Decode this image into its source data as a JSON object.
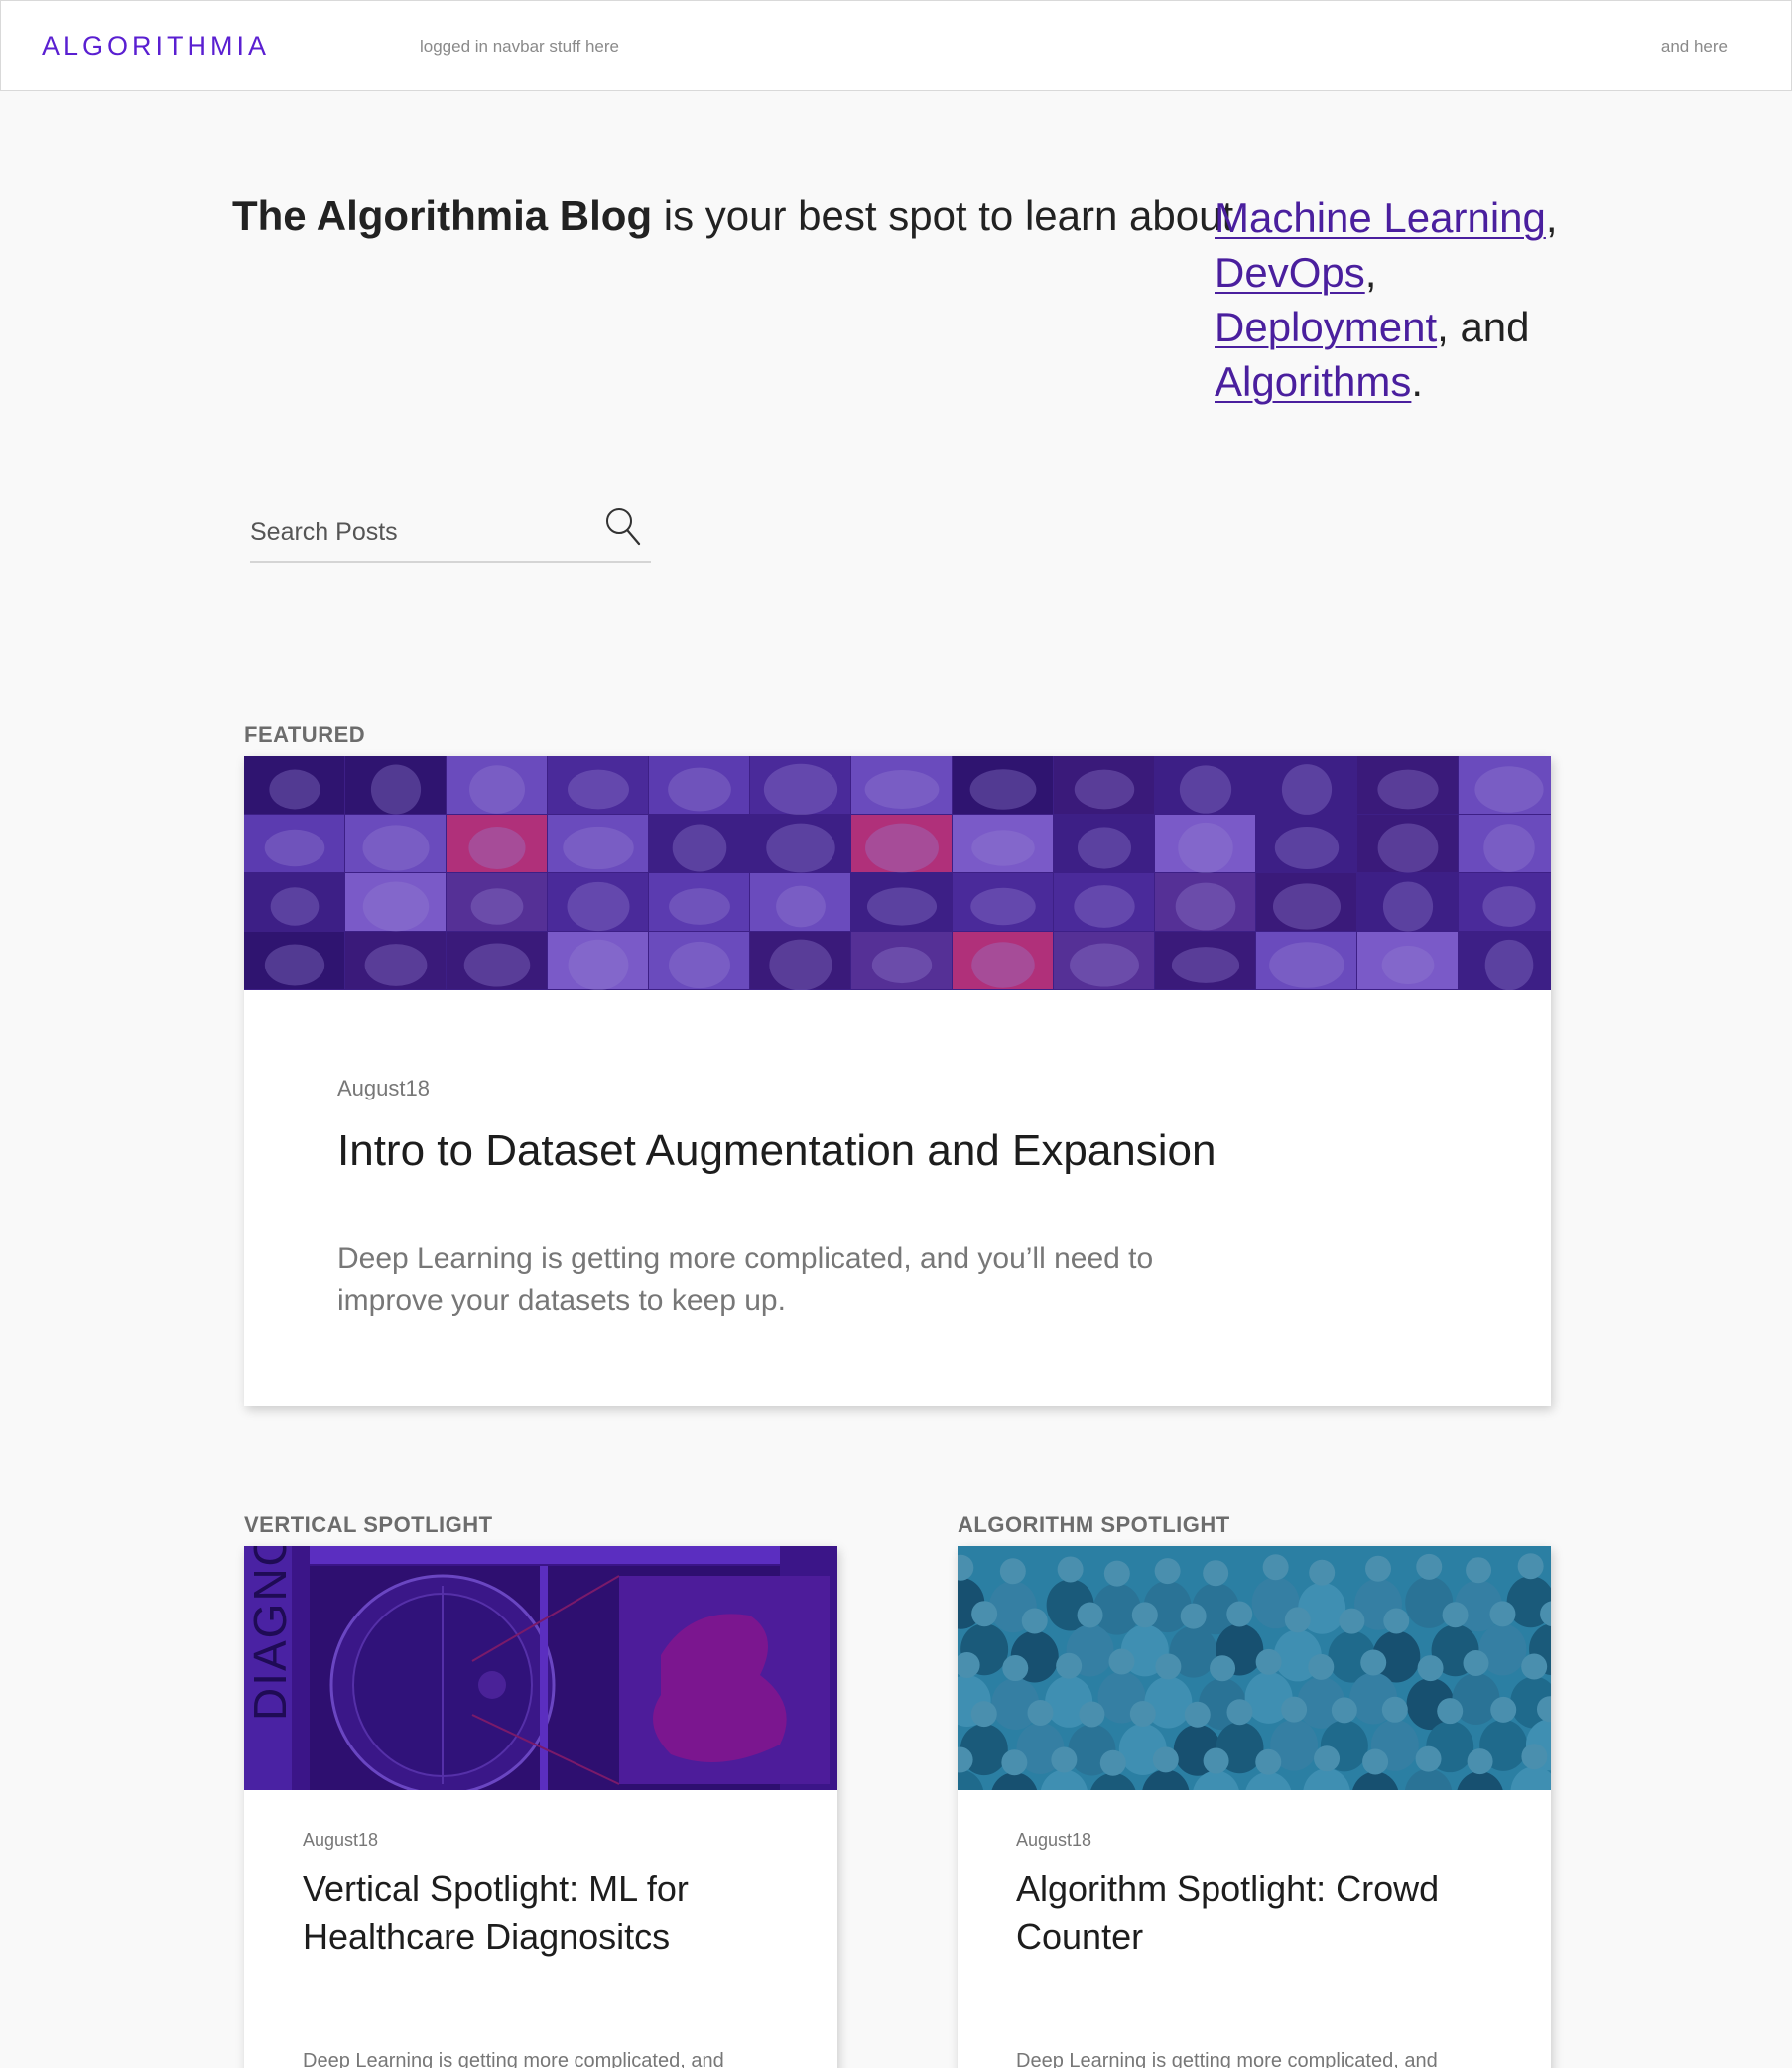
{
  "navbar": {
    "logo": "ALGORITHMIA",
    "left_text": "logged in navbar stuff here",
    "right_text": "and here"
  },
  "hero": {
    "blog_name": "The Algorithmia Blog",
    "tagline": " is your best spot to learn about",
    "topics": [
      "Machine Learning",
      "DevOps",
      "Deployment",
      "Algorithms"
    ],
    "sep1": ",",
    "sep2": ",",
    "sep3": ", and",
    "end": "."
  },
  "search": {
    "placeholder": "Search Posts"
  },
  "featured": {
    "label": "FEATURED",
    "date": "August18",
    "title": "Intro to Dataset Augmentation and Expansion",
    "excerpt": "Deep Learning is getting more complicated, and you’ll need to improve your datasets to keep up."
  },
  "vertical_spotlight": {
    "label": "VERTICAL SPOTLIGHT",
    "date": "August18",
    "title": "Vertical Spotlight: ML for Healthcare Diagnositcs",
    "excerpt": "Deep Learning is getting more complicated, and",
    "image_text": "DIAGNO"
  },
  "algorithm_spotlight": {
    "label": "ALGORITHM SPOTLIGHT",
    "date": "August18",
    "title": "Algorithm Spotlight: Crowd Counter",
    "excerpt": "Deep Learning is getting more complicated, and"
  },
  "colors": {
    "brand": "#5a1fd1",
    "link": "#4a1f9e",
    "background": "#f9f9f9"
  }
}
